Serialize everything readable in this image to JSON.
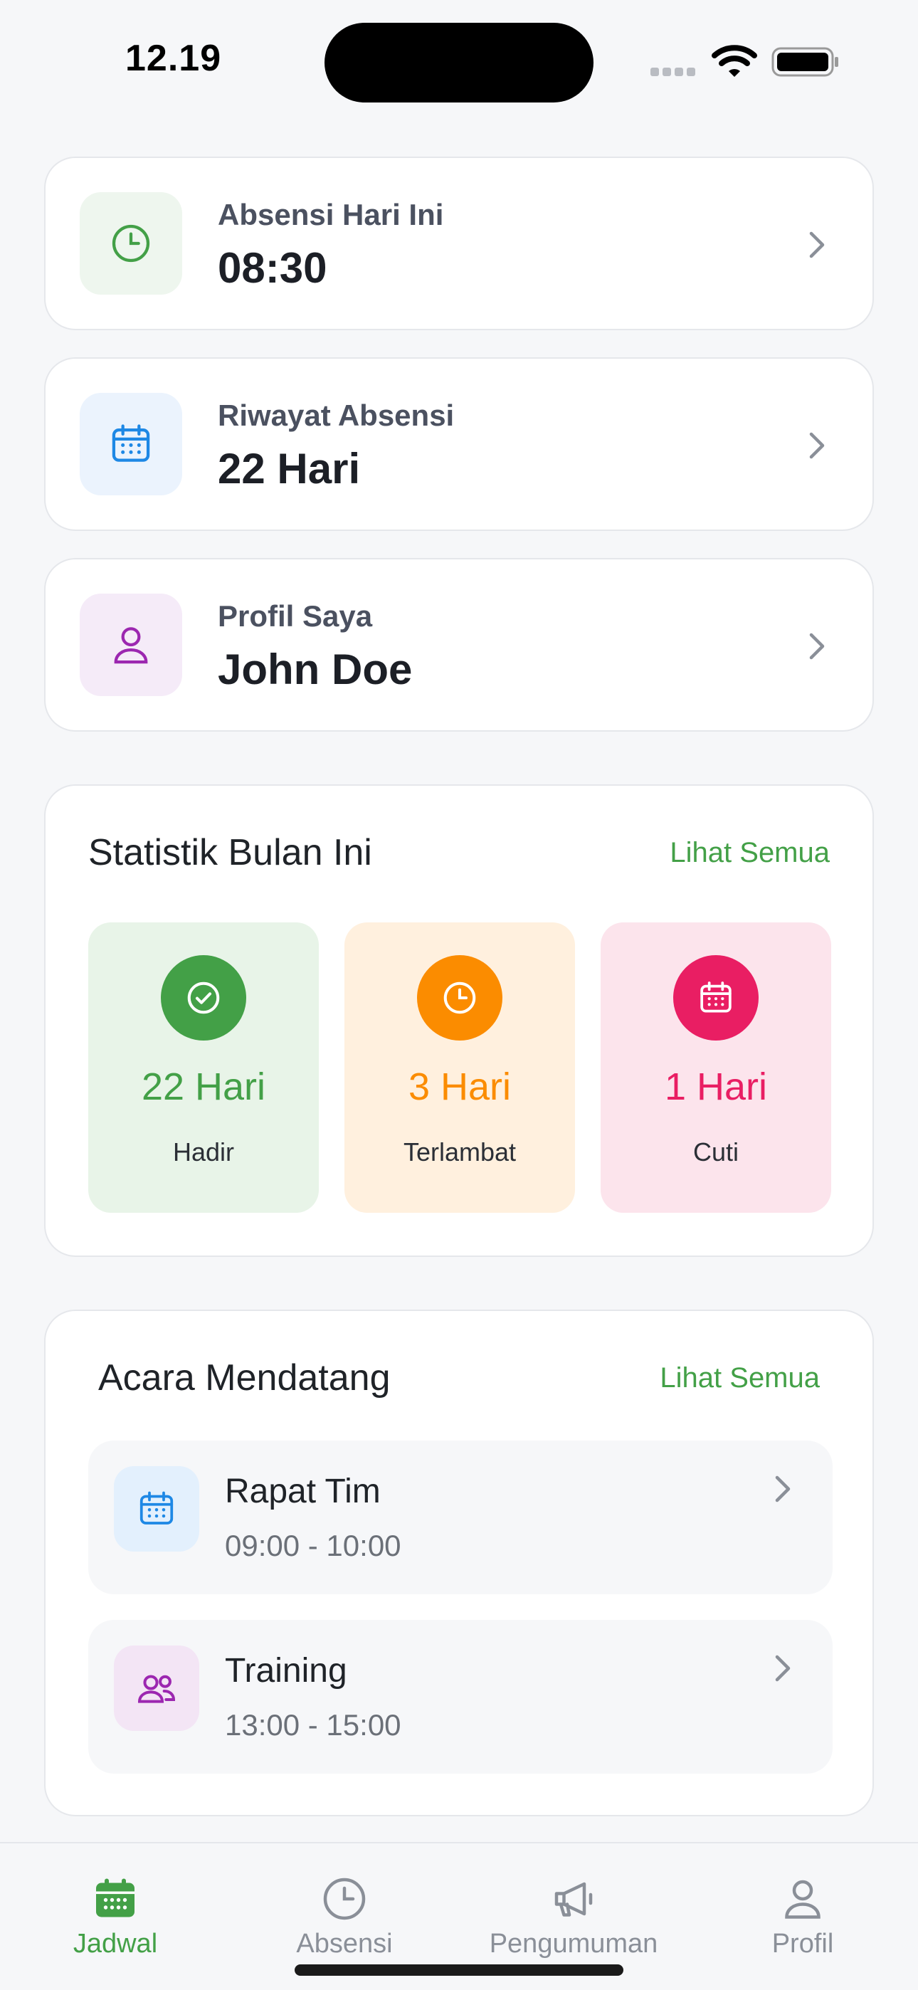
{
  "status_bar": {
    "time": "12.19"
  },
  "quick_cards": [
    {
      "label": "Absensi Hari Ini",
      "value": "08:30",
      "icon": "clock-icon",
      "icon_color": "#43a047",
      "icon_bg": "#eef6ee"
    },
    {
      "label": "Riwayat Absensi",
      "value": "22 Hari",
      "icon": "calendar-icon",
      "icon_color": "#1e88e5",
      "icon_bg": "#ebf3fd"
    },
    {
      "label": "Profil Saya",
      "value": "John Doe",
      "icon": "person-icon",
      "icon_color": "#9c27b0",
      "icon_bg": "#f5ebf8"
    }
  ],
  "stats": {
    "title": "Statistik Bulan Ini",
    "see_all": "Lihat Semua",
    "items": [
      {
        "value": "22 Hari",
        "label": "Hadir",
        "icon": "check-circle-icon",
        "color": "#43a047",
        "bg": "#e8f4e8"
      },
      {
        "value": "3 Hari",
        "label": "Terlambat",
        "icon": "clock-icon",
        "color": "#fb8c00",
        "bg": "#fff0de"
      },
      {
        "value": "1 Hari",
        "label": "Cuti",
        "icon": "calendar-icon",
        "color": "#e91e63",
        "bg": "#fce4ec"
      }
    ]
  },
  "events": {
    "title": "Acara Mendatang",
    "see_all": "Lihat Semua",
    "items": [
      {
        "title": "Rapat Tim",
        "time": "09:00 - 10:00",
        "icon": "calendar-icon",
        "color": "#1e88e5",
        "bg": "#e3f0fd"
      },
      {
        "title": "Training",
        "time": "13:00 - 15:00",
        "icon": "people-icon",
        "color": "#9c27b0",
        "bg": "#f3e5f5"
      }
    ]
  },
  "bottom_nav": {
    "active": "Jadwal",
    "items": [
      {
        "label": "Jadwal",
        "icon": "calendar-icon"
      },
      {
        "label": "Absensi",
        "icon": "clock-icon"
      },
      {
        "label": "Pengumuman",
        "icon": "megaphone-icon"
      },
      {
        "label": "Profil",
        "icon": "person-icon"
      }
    ]
  },
  "colors": {
    "accent": "#43a047",
    "background": "#f6f7f9",
    "card": "#ffffff",
    "muted": "#8a8f98"
  }
}
